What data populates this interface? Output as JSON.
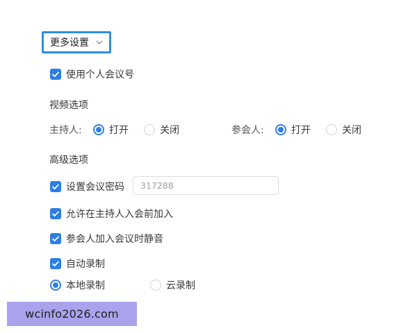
{
  "more_settings": {
    "label": "更多设置",
    "chevron_icon": "chevron-down-icon"
  },
  "personal_meeting_id": {
    "label": "使用个人会议号",
    "checked": true
  },
  "video": {
    "title": "视频选项",
    "host": {
      "label": "主持人:",
      "on_label": "打开",
      "off_label": "关闭",
      "selected": "打开"
    },
    "participants": {
      "label": "参会人:",
      "on_label": "打开",
      "off_label": "关闭",
      "selected": "打开"
    }
  },
  "advanced": {
    "title": "高级选项",
    "password": {
      "label": "设置会议密码",
      "checked": true,
      "value": "317288"
    },
    "join_before_host": {
      "label": "允许在主持人入会前加入",
      "checked": true
    },
    "mute_on_join": {
      "label": "参会人加入会议时静音",
      "checked": true
    },
    "auto_record": {
      "label": "自动录制",
      "checked": true,
      "local_label": "本地录制",
      "cloud_label": "云录制",
      "selected": "本地录制"
    }
  },
  "watermark": {
    "text": "wcinfo2026.com"
  },
  "colors": {
    "accent": "#2d7ee6",
    "focus_border": "#2d8de4",
    "watermark_bg": "#a9a2ec"
  }
}
